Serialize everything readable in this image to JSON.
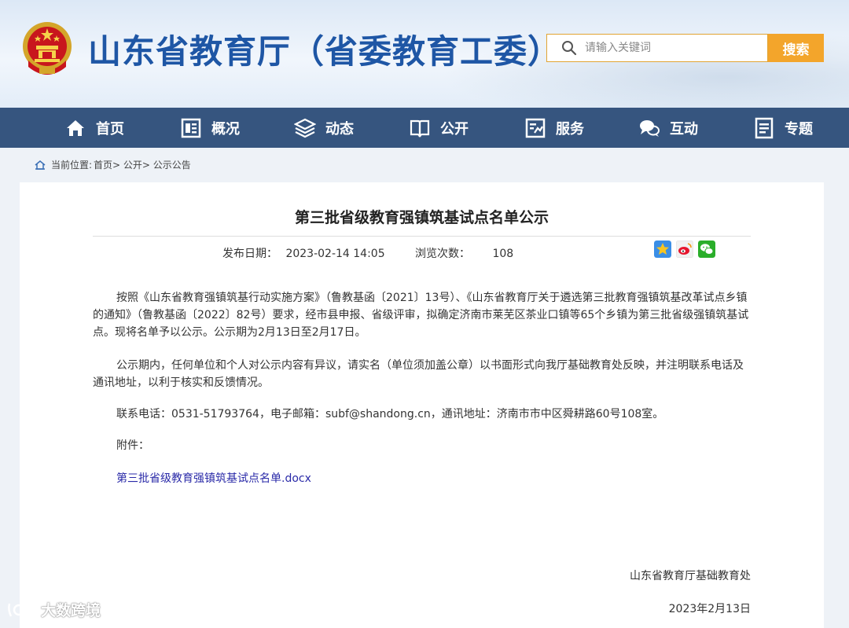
{
  "header": {
    "site_title": "山东省教育厅（省委教育工委）",
    "search_placeholder": "请输入关键词",
    "search_button": "搜索",
    "emblem_icon": "national-emblem-icon"
  },
  "nav": [
    {
      "label": "首页",
      "icon": "home-icon"
    },
    {
      "label": "概况",
      "icon": "overview-icon"
    },
    {
      "label": "动态",
      "icon": "news-icon"
    },
    {
      "label": "公开",
      "icon": "book-icon"
    },
    {
      "label": "服务",
      "icon": "service-icon"
    },
    {
      "label": "互动",
      "icon": "chat-icon"
    },
    {
      "label": "专题",
      "icon": "topic-icon"
    }
  ],
  "breadcrumb": {
    "prefix": "当前位置:",
    "path": "首页> 公开> 公示公告"
  },
  "article": {
    "title": "第三批省级教育强镇筑基试点名单公示",
    "publish_label": "发布日期：",
    "publish_date": "2023-02-14 14:05",
    "views_label": "浏览次数：",
    "views": "108",
    "paragraphs": [
      "按照《山东省教育强镇筑基行动实施方案》（鲁教基函〔2021〕13号）、《山东省教育厅关于遴选第三批教育强镇筑基改革试点乡镇的通知》（鲁教基函〔2022〕82号）要求，经市县申报、省级评审，拟确定济南市莱芜区茶业口镇等65个乡镇为第三批省级强镇筑基试点。现将名单予以公示。公示期为2月13日至2月17日。",
      "公示期内，任何单位和个人对公示内容有异议，请实名（单位须加盖公章）以书面形式向我厅基础教育处反映，并注明联系电话及通讯地址，以利于核实和反馈情况。",
      "联系电话：0531-51793764，电子邮箱：subf@shandong.cn，通讯地址：济南市市中区舜耕路60号108室。",
      "附件："
    ],
    "attachment": "第三批省级教育强镇筑基试点名单.docx",
    "signature": "山东省教育厅基础教育处",
    "sign_date": "2023年2月13日"
  },
  "share_icons": [
    "favorite-icon",
    "weibo-icon",
    "wechat-icon"
  ],
  "watermark": "大数跨境",
  "colors": {
    "brand_blue": "#1e56a5",
    "nav_bg": "#36557f",
    "accent_orange": "#f3a52b",
    "link_blue": "#2a2aa8"
  }
}
